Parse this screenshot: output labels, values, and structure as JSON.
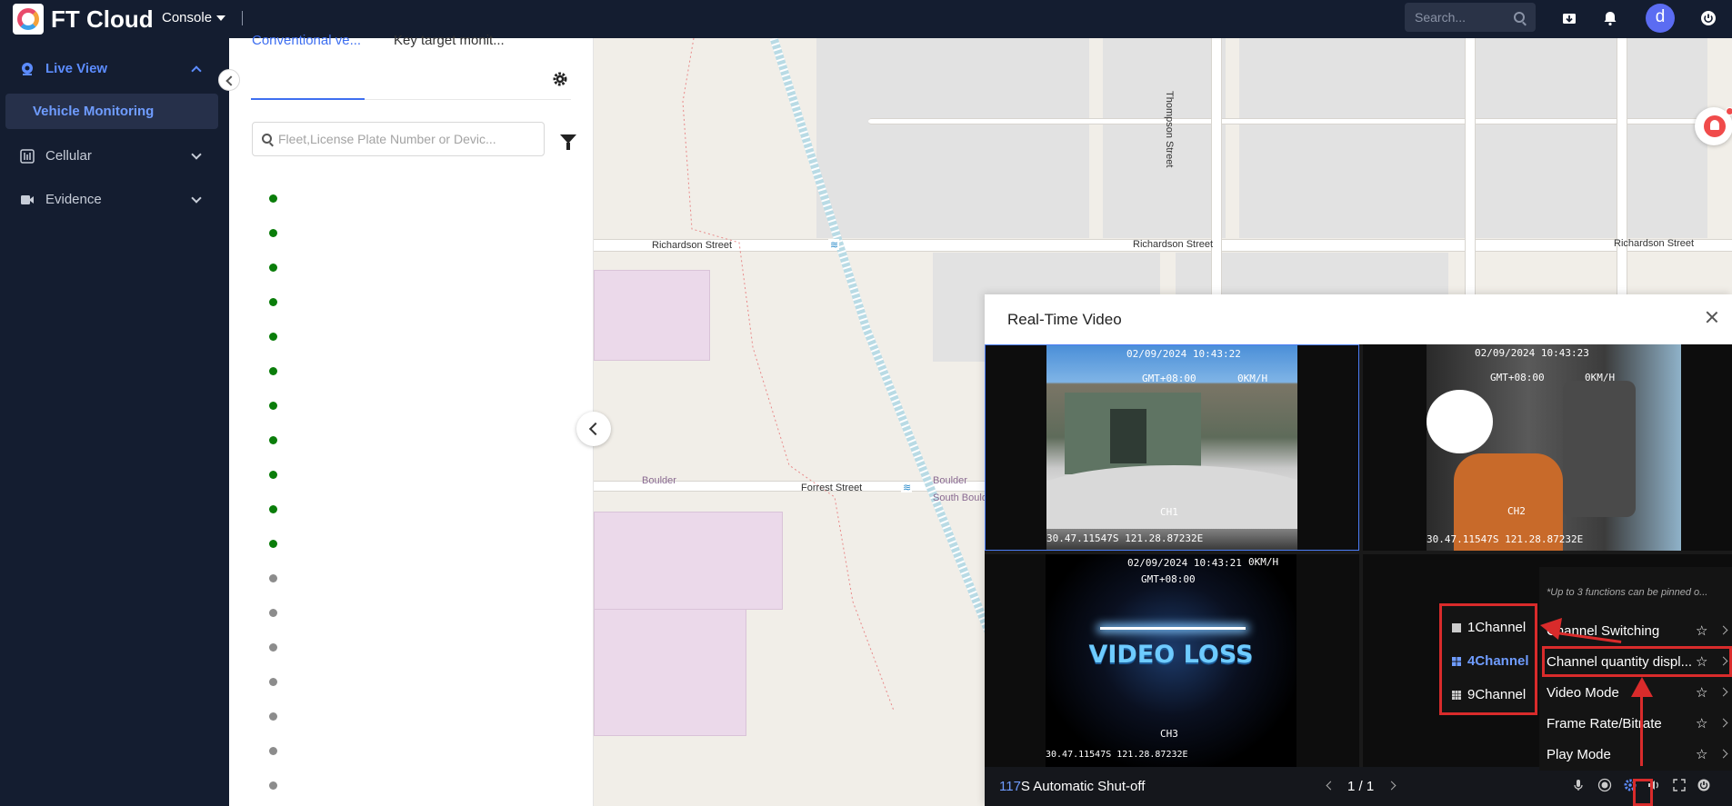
{
  "app": {
    "brand": "FT Cloud",
    "console_label": "Console",
    "search_placeholder": "Search...",
    "avatar_initial": "d"
  },
  "sidebar": {
    "items": [
      {
        "label": "Live View",
        "active": true
      },
      {
        "label": "Vehicle Monitoring"
      },
      {
        "label": "Cellular"
      },
      {
        "label": "Evidence"
      }
    ]
  },
  "vehicle_panel": {
    "tabs": [
      "Conventional ve...",
      "Key target monit..."
    ],
    "search_placeholder": "Fleet,License Plate Number or Devic...",
    "status_dots": [
      "online",
      "online",
      "online",
      "online",
      "online",
      "online",
      "online",
      "online",
      "online",
      "online",
      "online",
      "offline",
      "offline",
      "offline",
      "offline",
      "offline",
      "offline",
      "offline"
    ]
  },
  "map": {
    "streets": [
      "Richardson Street",
      "Richardson Street",
      "Richardson Street",
      "Thompson Street",
      "Forrest Street"
    ],
    "suburbs": [
      "Boulder",
      "Boulder",
      "South Bould"
    ]
  },
  "video_panel": {
    "title": "Real-Time Video",
    "channels": [
      {
        "timestamp": "02/09/2024 10:43:22",
        "tz": "GMT+08:00",
        "speed": "0KM/H",
        "label": "CH1",
        "coords": "30.47.11547S 121.28.87232E"
      },
      {
        "timestamp": "02/09/2024 10:43:23",
        "tz": "GMT+08:00",
        "speed": "0KM/H",
        "label": "CH2",
        "coords": "30.47.11547S 121.28.87232E"
      },
      {
        "timestamp": "02/09/2024 10:43:21",
        "tz": "GMT+08:00",
        "speed": "0KM/H",
        "label": "CH3",
        "coords": "30.47.11547S 121.28.87232E",
        "overlay": "VIDEO LOSS"
      }
    ],
    "countdown_number": "117",
    "countdown_text": "S Automatic Shut-off",
    "pager": "1 / 1"
  },
  "settings_menu": {
    "note": "*Up to 3 functions can be pinned o...",
    "items": [
      "Channel Switching",
      "Channel quantity displ...",
      "Video Mode",
      "Frame Rate/Bitrate",
      "Play Mode"
    ]
  },
  "channel_submenu": {
    "options": [
      "1Channel",
      "4Channel",
      "9Channel"
    ],
    "selected": "4Channel"
  },
  "colors": {
    "accent": "#3e6ff0",
    "online": "#0a7d0a",
    "offline": "#8c8c8c",
    "annotation": "#d92b2b"
  }
}
